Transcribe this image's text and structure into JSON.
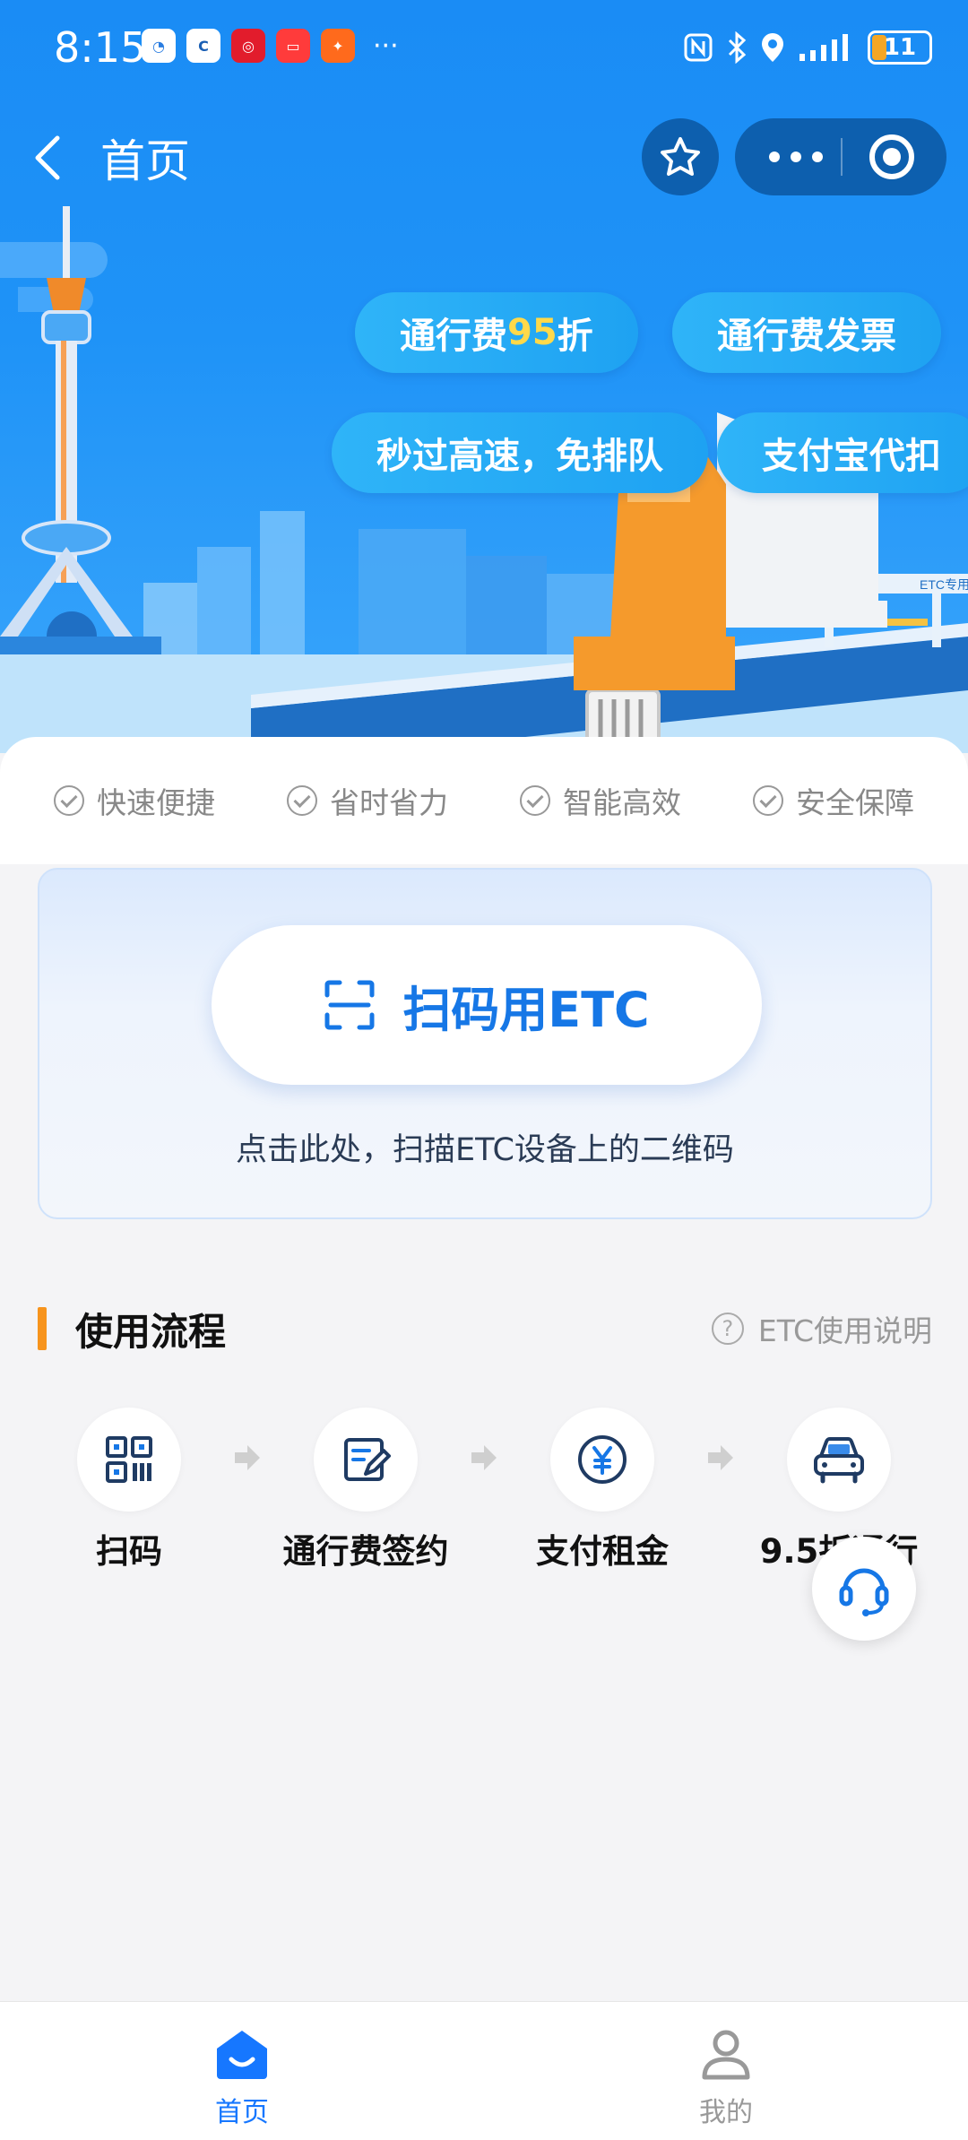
{
  "status_bar": {
    "time": "8:15",
    "battery": "11",
    "apps": [
      "chat-app-icon",
      "browser-app-icon",
      "byd-app-icon",
      "book-app-icon",
      "taobao-app-icon"
    ],
    "more": "···"
  },
  "navbar": {
    "title": "首页"
  },
  "banner": {
    "pills": [
      {
        "pre": "通行费",
        "highlight": "95",
        "post": "折"
      },
      {
        "pre": "通行费发票",
        "highlight": "",
        "post": ""
      },
      {
        "pre": "秒过高速，免排队",
        "highlight": "",
        "post": ""
      },
      {
        "pre": "支付宝代扣",
        "highlight": "",
        "post": ""
      }
    ],
    "gantry_label": "ETC专用"
  },
  "features": [
    "快速便捷",
    "省时省力",
    "智能高效",
    "安全保障"
  ],
  "scan": {
    "button_label": "扫码用ETC",
    "hint": "点击此处，扫描ETC设备上的二维码"
  },
  "process": {
    "title": "使用流程",
    "help_label": "ETC使用说明",
    "help_icon": "?",
    "steps": [
      {
        "label": "扫码",
        "icon": "qrcode-icon"
      },
      {
        "label": "通行费签约",
        "icon": "sign-contract-icon"
      },
      {
        "label": "支付租金",
        "icon": "yen-coin-icon"
      },
      {
        "label": "9.5折通行",
        "icon": "car-icon"
      }
    ]
  },
  "tabbar": {
    "tabs": [
      {
        "label": "首页",
        "icon": "home-icon",
        "active": true
      },
      {
        "label": "我的",
        "icon": "user-icon",
        "active": false
      }
    ]
  },
  "colors": {
    "brand_blue": "#1677ff",
    "banner_blue": "#1a8cf5",
    "accent_orange": "#f7941d",
    "highlight_yellow": "#ffd94a"
  }
}
